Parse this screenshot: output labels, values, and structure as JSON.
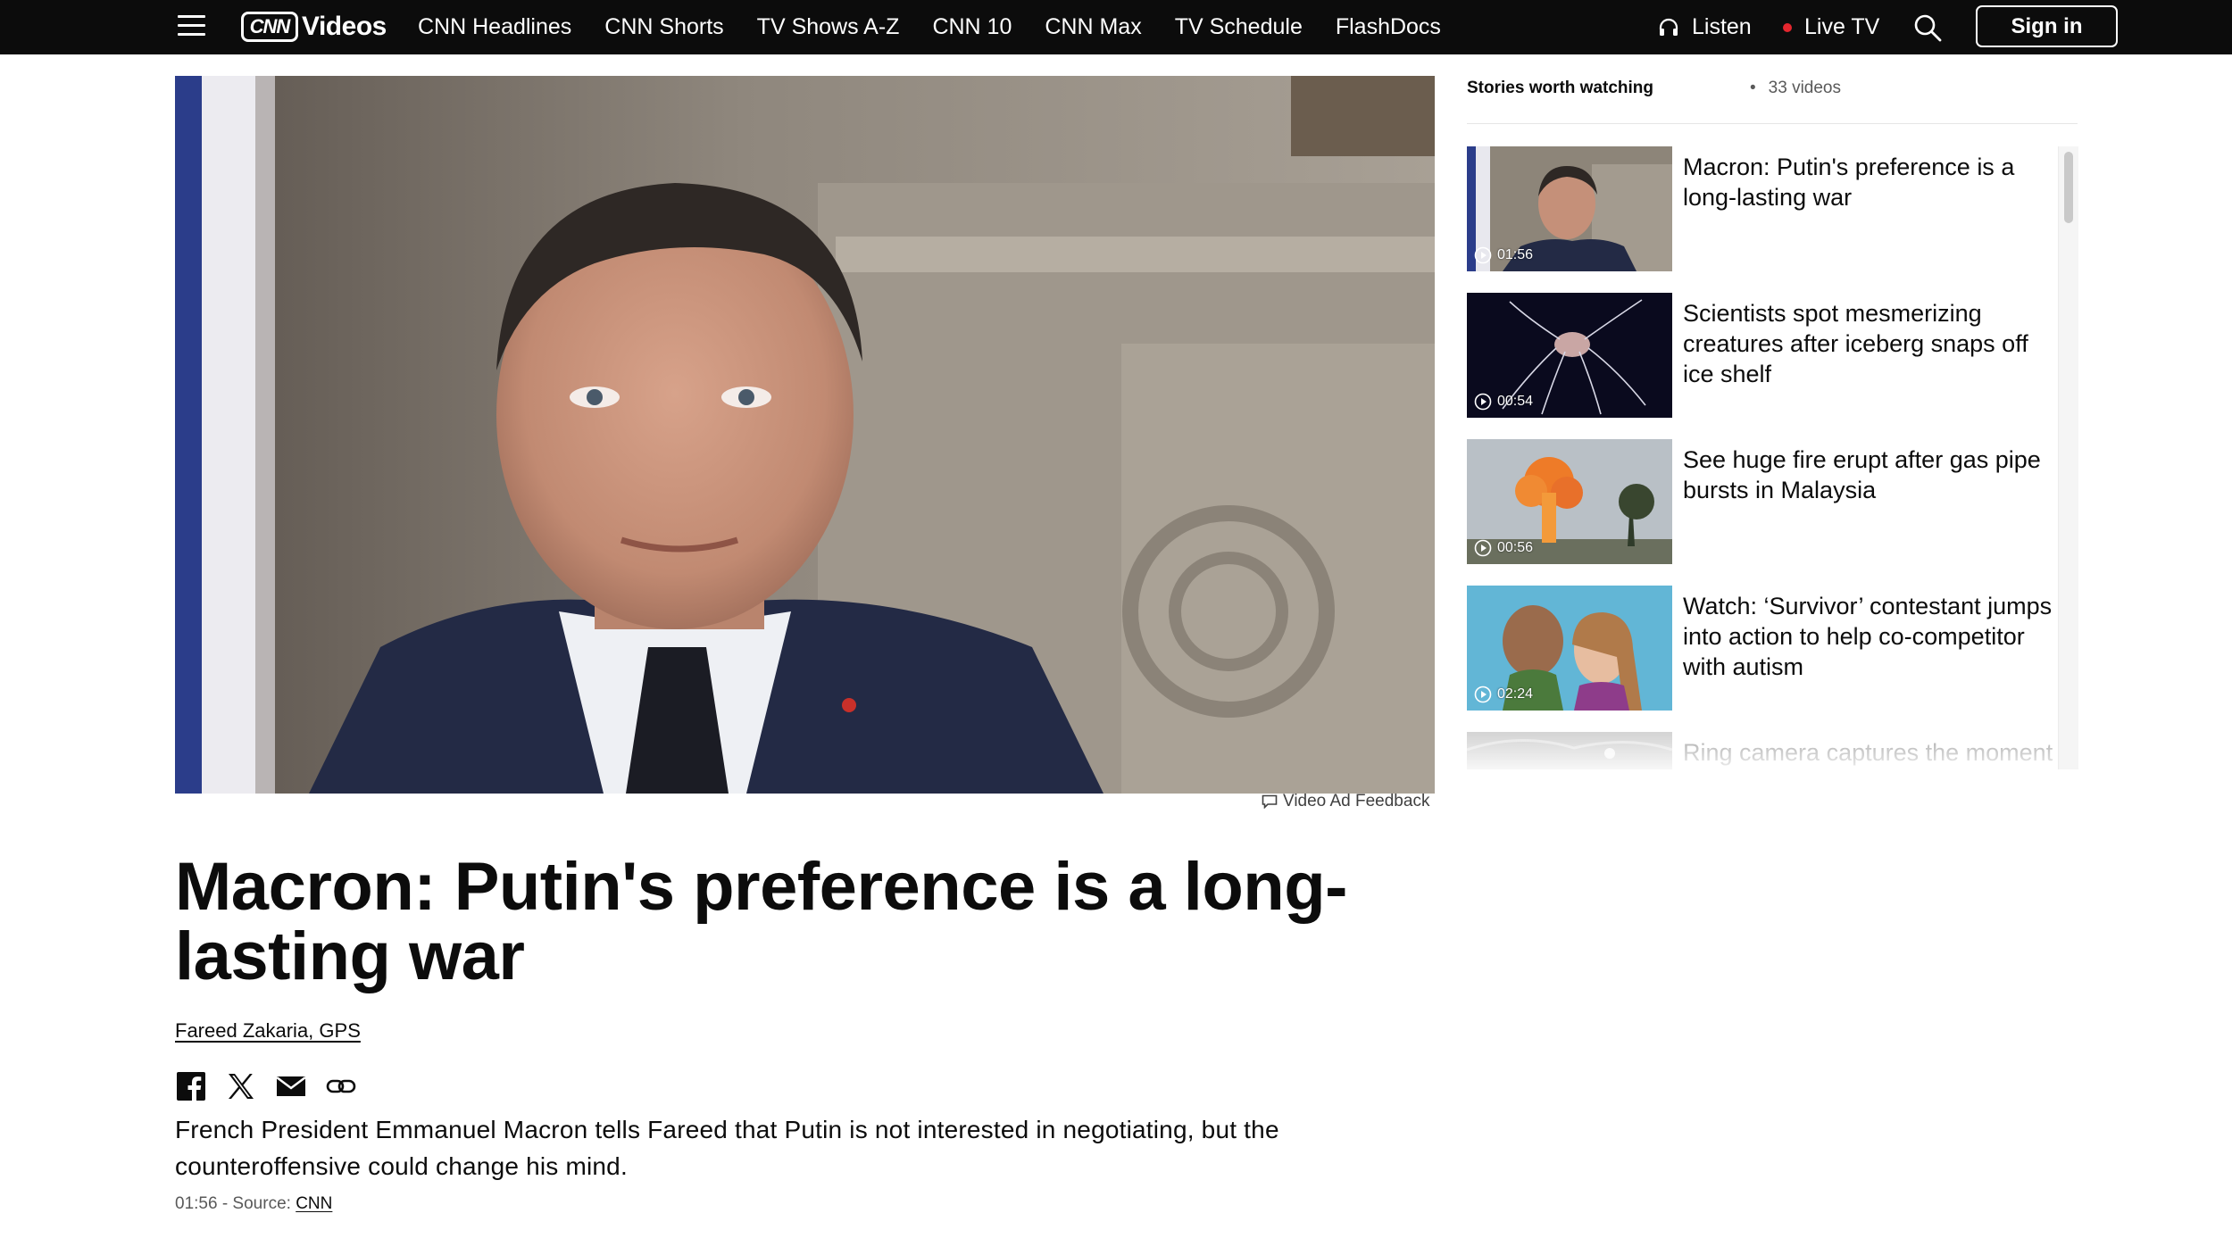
{
  "nav": {
    "logo_text": "CNN",
    "section_title": "Videos",
    "links": [
      "CNN Headlines",
      "CNN Shorts",
      "TV Shows A-Z",
      "CNN 10",
      "CNN Max",
      "TV Schedule",
      "FlashDocs"
    ],
    "listen_label": "Listen",
    "live_tv_label": "Live TV",
    "sign_in_label": "Sign in",
    "live_dot_color": "#e4262e"
  },
  "video": {
    "ad_feedback_label": "Video Ad Feedback",
    "headline": "Macron: Putin's preference is a long-lasting war",
    "byline": "Fareed Zakaria, GPS",
    "share_icons": [
      "facebook-icon",
      "x-icon",
      "email-icon",
      "link-icon"
    ],
    "description": "French President Emmanuel Macron tells Fareed that Putin is not interested in negotiating, but the counteroffensive could change his mind.",
    "duration": "01:56",
    "source_prefix": "- Source:",
    "source": "CNN"
  },
  "playlist": {
    "title": "Stories worth watching",
    "count": "33 videos",
    "items": [
      {
        "duration": "01:56",
        "title": "Macron: Putin's preference is a long-lasting war"
      },
      {
        "duration": "00:54",
        "title": "Scientists spot mesmerizing creatures after iceberg snaps off ice shelf"
      },
      {
        "duration": "00:56",
        "title": "See huge fire erupt after gas pipe bursts in Malaysia"
      },
      {
        "duration": "02:24",
        "title": "Watch: ‘Survivor’ contestant jumps into action to help co-competitor with autism"
      },
      {
        "duration": "",
        "title": "Ring camera captures the moment"
      }
    ]
  }
}
